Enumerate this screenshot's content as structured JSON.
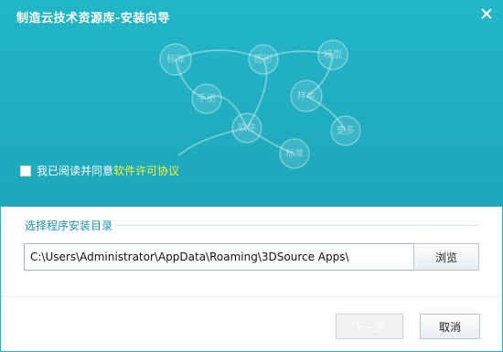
{
  "window": {
    "title": "制造云技术资源库-安装向导"
  },
  "header": {
    "close_icon": "close-icon",
    "network_nodes": [
      "标准",
      "图形",
      "模型",
      "手册",
      "样本",
      "软件",
      "更多",
      "标准"
    ],
    "accent_color": "#21b6c7"
  },
  "agreement": {
    "prefix_text": "我已阅读并同意",
    "link_text": "软件许可协议",
    "checked": false,
    "link_color": "#f7f23a"
  },
  "install": {
    "section_title": "选择程序安装目录",
    "path_value": "C:\\Users\\Administrator\\AppData\\Roaming\\3DSource Apps\\",
    "browse_label": "浏览"
  },
  "buttons": {
    "next_label": "下一步",
    "cancel_label": "取消",
    "next_enabled": false
  }
}
